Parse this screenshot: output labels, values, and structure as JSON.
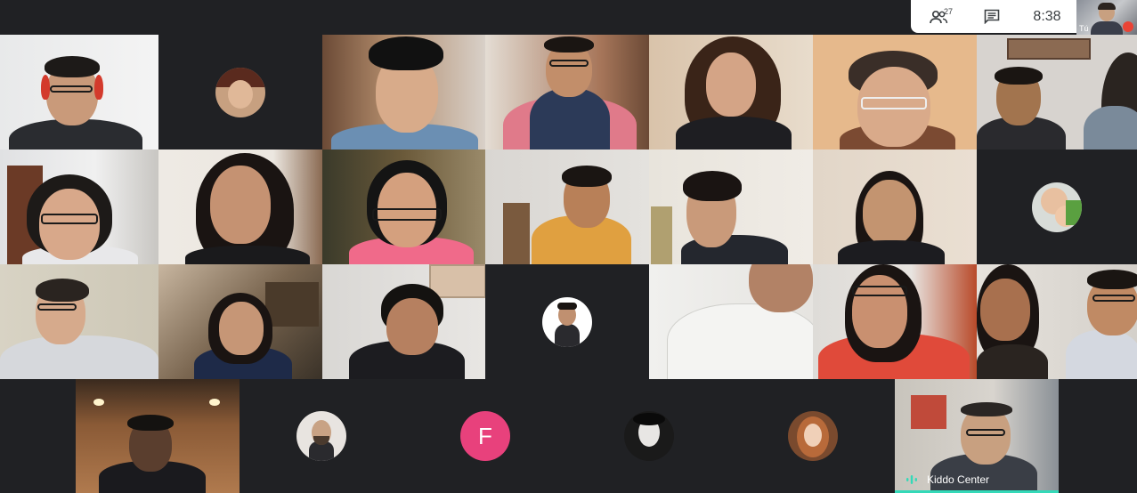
{
  "top_panel": {
    "participants_icon": "people-icon",
    "participant_count": "27",
    "chat_icon": "chat-icon",
    "clock": "8:38"
  },
  "self_view": {
    "you_label": "Tú",
    "mic_icon": "mic-off-icon"
  },
  "tiles": {
    "featured": {
      "name": "Kiddo Center",
      "icon": "audio-waveform-icon"
    },
    "letter_avatar": "F"
  },
  "colors": {
    "background": "#202124",
    "letter_avatar_bg": "#e8417c",
    "speaking_accent": "#1a73e8"
  }
}
